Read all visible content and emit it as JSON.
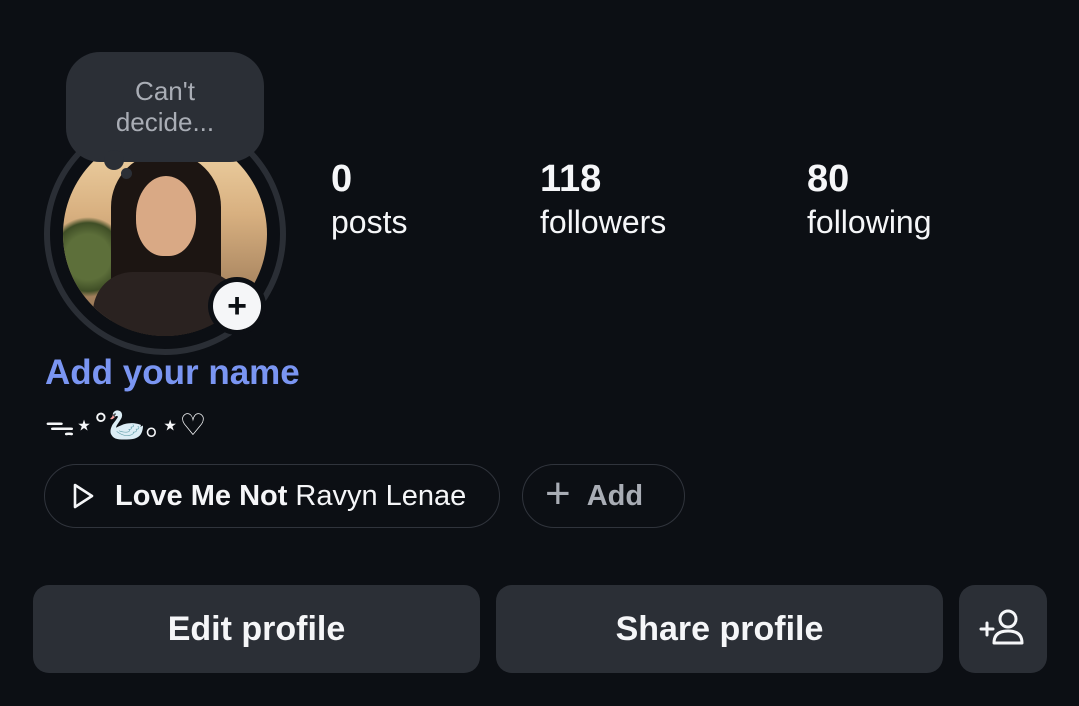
{
  "note": {
    "text_line1": "Can't",
    "text_line2": "decide..."
  },
  "add_story_icon": "plus-icon",
  "stats": [
    {
      "value": "0",
      "label": "posts"
    },
    {
      "value": "118",
      "label": "followers"
    },
    {
      "value": "80",
      "label": "following"
    }
  ],
  "profile": {
    "name_placeholder": "Add your name",
    "bio": "ᯓ⋆°🦢｡⋆♡",
    "name_color": "#7a95f2"
  },
  "music": {
    "song": "Love Me Not",
    "artist": "Ravyn Lenae",
    "icon": "play-icon"
  },
  "add_chip": {
    "label": "Add",
    "icon": "plus-icon"
  },
  "buttons": {
    "edit": "Edit profile",
    "share": "Share profile",
    "add_friend_icon": "add-person-icon"
  },
  "colors": {
    "background": "#0c0f14",
    "surface": "#2b2f36",
    "accent": "#7a95f2"
  }
}
